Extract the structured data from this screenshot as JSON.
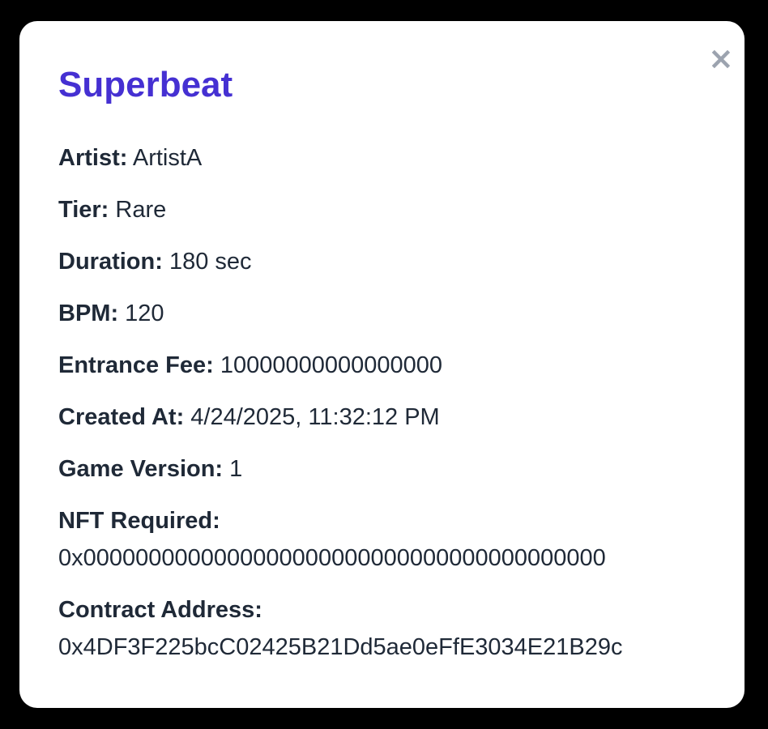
{
  "modal": {
    "title": "Superbeat",
    "close_label": "×",
    "title_color": "#4530d2",
    "fields": [
      {
        "label": "Artist:",
        "value": "ArtistA"
      },
      {
        "label": "Tier:",
        "value": "Rare"
      },
      {
        "label": "Duration:",
        "value": "180 sec"
      },
      {
        "label": "BPM:",
        "value": "120"
      },
      {
        "label": "Entrance Fee:",
        "value": "10000000000000000"
      },
      {
        "label": "Created At:",
        "value": "4/24/2025, 11:32:12 PM"
      },
      {
        "label": "Game Version:",
        "value": "1"
      },
      {
        "label": "NFT Required:",
        "value": "0x0000000000000000000000000000000000000000"
      },
      {
        "label": "Contract Address:",
        "value": "0x4DF3F225bcC02425B21Dd5ae0eFfE3034E21B29c"
      }
    ]
  }
}
